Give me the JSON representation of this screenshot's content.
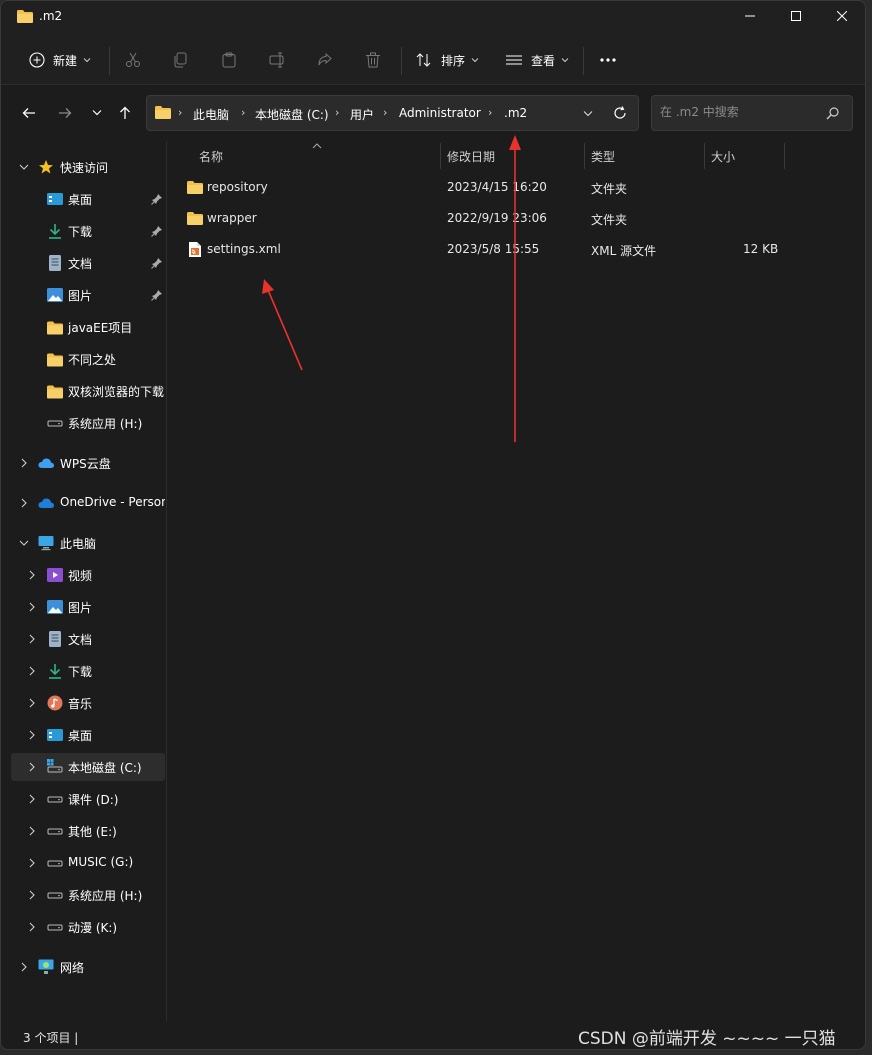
{
  "window": {
    "title": ".m2"
  },
  "toolbar": {
    "new_label": "新建",
    "sort_label": "排序",
    "view_label": "查看"
  },
  "address": {
    "crumbs": [
      "此电脑",
      "本地磁盘 (C:)",
      "用户",
      "Administrator",
      ".m2"
    ]
  },
  "search": {
    "placeholder": "在 .m2 中搜索"
  },
  "sidebar": {
    "quick_access": "快速访问",
    "quick_items": [
      "桌面",
      "下载",
      "文档",
      "图片",
      "javaEE项目",
      "不同之处",
      "双核浏览器的下载",
      "系统应用 (H:)"
    ],
    "wps": "WPS云盘",
    "onedrive": "OneDrive - Personal",
    "this_pc": "此电脑",
    "pc_items": [
      "视频",
      "图片",
      "文档",
      "下载",
      "音乐",
      "桌面",
      "本地磁盘 (C:)",
      "课件 (D:)",
      "其他 (E:)",
      "MUSIC (G:)",
      "系统应用 (H:)",
      "动漫 (K:)"
    ],
    "network": "网络"
  },
  "columns": {
    "name": "名称",
    "modified": "修改日期",
    "type": "类型",
    "size": "大小"
  },
  "files": [
    {
      "name": "repository",
      "modified": "2023/4/15 16:20",
      "type": "文件夹",
      "size": ""
    },
    {
      "name": "wrapper",
      "modified": "2022/9/19 23:06",
      "type": "文件夹",
      "size": ""
    },
    {
      "name": "settings.xml",
      "modified": "2023/5/8 15:55",
      "type": "XML 源文件",
      "size": "12 KB"
    }
  ],
  "status": {
    "count": "3 个项目  |"
  },
  "watermark": "CSDN @前端开发  ~~~~ 一只猫"
}
